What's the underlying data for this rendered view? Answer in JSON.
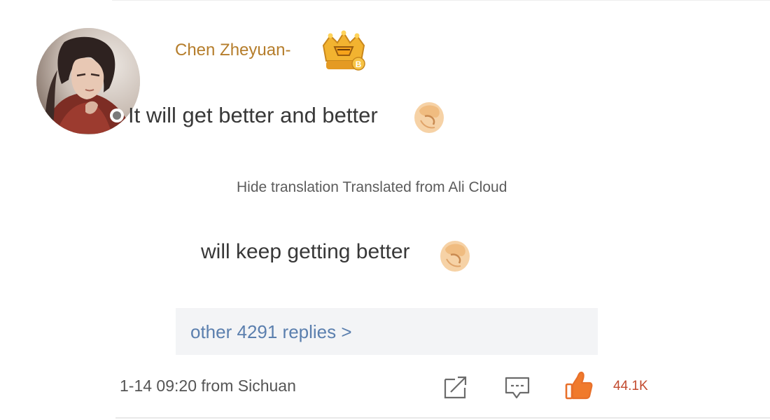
{
  "comment": {
    "username": "Chen Zheyuan-",
    "text": "It will get better and better",
    "emoji_icon": "fist-bump-icon",
    "badge_icon": "vip-crown-badge-icon"
  },
  "translation": {
    "toggle_label": "Hide translation",
    "source_label": "Translated from Ali Cloud",
    "text": "will keep getting better"
  },
  "replies": {
    "link_label": "other 4291 replies >"
  },
  "footer": {
    "timestamp": "1-14 09:20",
    "location": "from Sichuan",
    "share_icon": "share-icon",
    "comment_icon": "comment-icon",
    "like_icon": "thumbs-up-icon",
    "like_count": "44.1K"
  },
  "colors": {
    "username": "#b57d2b",
    "link": "#5b7fae",
    "like": "#e8702a",
    "like_count": "#c24a2e",
    "replies_bg": "#f3f4f6"
  }
}
